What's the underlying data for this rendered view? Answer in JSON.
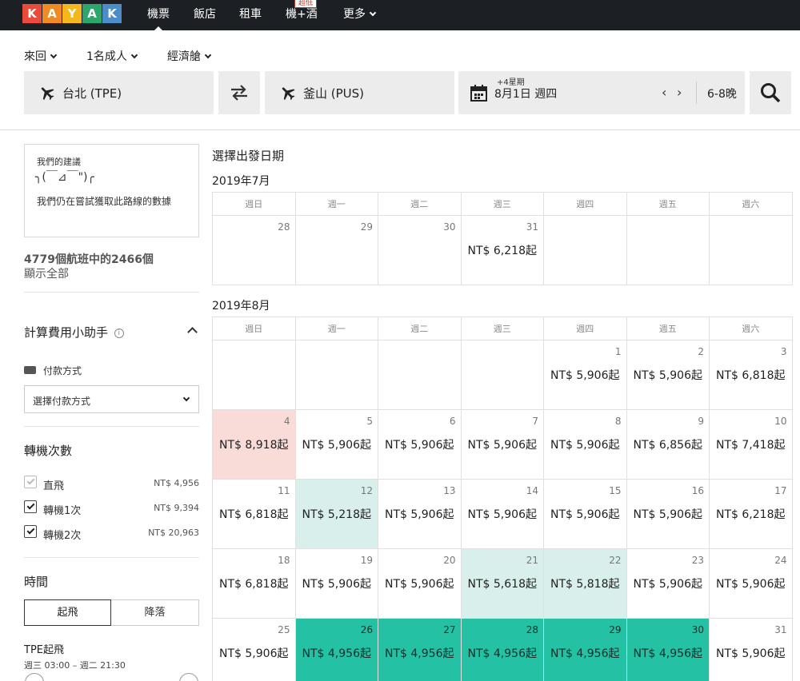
{
  "nav": {
    "logo_letters": [
      "K",
      "A",
      "Y",
      "A",
      "K"
    ],
    "logo_colors": [
      "#e84b3a",
      "#f08a23",
      "#f5b71c",
      "#2ea66b",
      "#4c8cc9"
    ],
    "items": [
      {
        "label": "機票"
      },
      {
        "label": "飯店"
      },
      {
        "label": "租車"
      },
      {
        "label": "機+酒"
      },
      {
        "label": "更多"
      }
    ],
    "badge": "超低"
  },
  "options": {
    "trip_type": "來回",
    "travelers": "1名成人",
    "cabin": "經濟艙"
  },
  "search": {
    "origin": "台北 (TPE)",
    "destination": "釜山 (PUS)",
    "date_hint": "+4星期",
    "date": "8月1日 週四",
    "nights": "6-8晚"
  },
  "sidebar": {
    "suggest_title": "我們的建議",
    "suggest_face": "╮(￣⊿￣\")╭",
    "suggest_text": "我們仍在嘗試獲取此路線的數據",
    "results_count": "4779個航班中的2466個",
    "show_all": "顯示全部",
    "calculator_title": "計算費用小助手",
    "payment_label": "付款方式",
    "payment_select": "選擇付款方式",
    "stops_title": "轉機次數",
    "stops": [
      {
        "label": "直飛",
        "price": "NT$ 4,956",
        "checked": true,
        "disabled": true
      },
      {
        "label": "轉機1次",
        "price": "NT$ 9,394",
        "checked": true,
        "disabled": false
      },
      {
        "label": "轉機2次",
        "price": "NT$ 20,963",
        "checked": true,
        "disabled": false
      }
    ],
    "time_title": "時間",
    "time_tabs": [
      "起飛",
      "降落"
    ],
    "tpe_title": "TPE起飛",
    "tpe_range": "週三 03:00 – 週二 21:30"
  },
  "calendar": {
    "heading": "選擇出發日期",
    "weekdays": [
      "週日",
      "週一",
      "週二",
      "週三",
      "週四",
      "週五",
      "週六"
    ],
    "months": [
      {
        "title": "2019年7月",
        "weeks": [
          [
            {
              "day": "28",
              "price": ""
            },
            {
              "day": "29",
              "price": ""
            },
            {
              "day": "30",
              "price": ""
            },
            {
              "day": "31",
              "price": "NT$ 6,218起"
            },
            {
              "day": "",
              "price": ""
            },
            {
              "day": "",
              "price": ""
            },
            {
              "day": "",
              "price": ""
            }
          ]
        ]
      },
      {
        "title": "2019年8月",
        "weeks": [
          [
            {
              "day": "",
              "price": ""
            },
            {
              "day": "",
              "price": ""
            },
            {
              "day": "",
              "price": ""
            },
            {
              "day": "",
              "price": ""
            },
            {
              "day": "1",
              "price": "NT$ 5,906起"
            },
            {
              "day": "2",
              "price": "NT$ 5,906起"
            },
            {
              "day": "3",
              "price": "NT$ 6,818起"
            }
          ],
          [
            {
              "day": "4",
              "price": "NT$ 8,918起",
              "color": "#f9dcd8"
            },
            {
              "day": "5",
              "price": "NT$ 5,906起"
            },
            {
              "day": "6",
              "price": "NT$ 5,906起"
            },
            {
              "day": "7",
              "price": "NT$ 5,906起"
            },
            {
              "day": "8",
              "price": "NT$ 5,906起"
            },
            {
              "day": "9",
              "price": "NT$ 6,856起"
            },
            {
              "day": "10",
              "price": "NT$ 7,418起"
            }
          ],
          [
            {
              "day": "11",
              "price": "NT$ 6,818起"
            },
            {
              "day": "12",
              "price": "NT$ 5,218起",
              "color": "#d8efec"
            },
            {
              "day": "13",
              "price": "NT$ 5,906起"
            },
            {
              "day": "14",
              "price": "NT$ 5,906起"
            },
            {
              "day": "15",
              "price": "NT$ 5,906起"
            },
            {
              "day": "16",
              "price": "NT$ 5,906起"
            },
            {
              "day": "17",
              "price": "NT$ 6,218起"
            }
          ],
          [
            {
              "day": "18",
              "price": "NT$ 6,818起"
            },
            {
              "day": "19",
              "price": "NT$ 5,906起"
            },
            {
              "day": "20",
              "price": "NT$ 5,906起"
            },
            {
              "day": "21",
              "price": "NT$ 5,618起",
              "color": "#d8efec"
            },
            {
              "day": "22",
              "price": "NT$ 5,818起",
              "color": "#d8efec"
            },
            {
              "day": "23",
              "price": "NT$ 5,906起"
            },
            {
              "day": "24",
              "price": "NT$ 5,906起"
            }
          ],
          [
            {
              "day": "25",
              "price": "NT$ 5,906起"
            },
            {
              "day": "26",
              "price": "NT$ 4,956起",
              "color": "#25c1a4"
            },
            {
              "day": "27",
              "price": "NT$ 4,956起",
              "color": "#25c1a4"
            },
            {
              "day": "28",
              "price": "NT$ 4,956起",
              "color": "#25c1a4"
            },
            {
              "day": "29",
              "price": "NT$ 4,956起",
              "color": "#25c1a4"
            },
            {
              "day": "30",
              "price": "NT$ 4,956起",
              "color": "#25c1a4"
            },
            {
              "day": "31",
              "price": "NT$ 5,906起"
            }
          ]
        ]
      }
    ]
  }
}
